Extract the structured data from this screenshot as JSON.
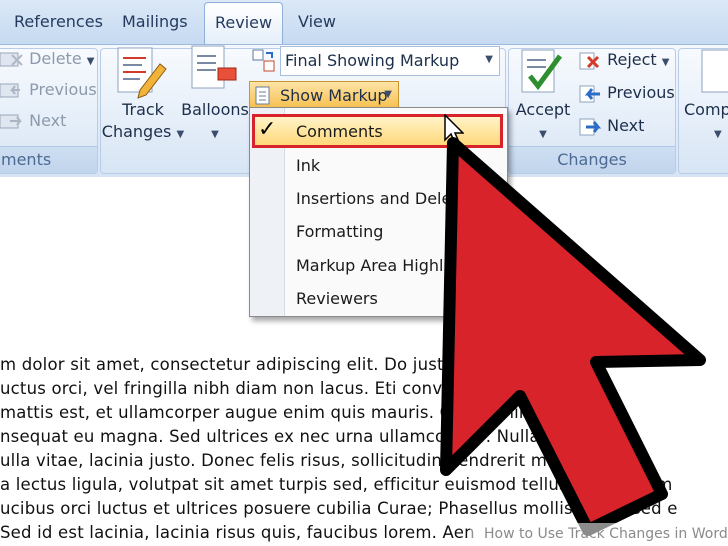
{
  "tabs": [
    {
      "label": "References",
      "active": false
    },
    {
      "label": "Mailings",
      "active": false
    },
    {
      "label": "Review",
      "active": true
    },
    {
      "label": "View",
      "active": false
    }
  ],
  "comments_group": {
    "label": "ments",
    "delete": "Delete",
    "previous": "Previous",
    "next": "Next"
  },
  "tracking_group": {
    "track_changes_line1": "Track",
    "track_changes_line2": "Changes",
    "balloons": "Balloons",
    "markup_select": "Final Showing Markup",
    "show_markup": "Show Markup"
  },
  "changes_group": {
    "label": "Changes",
    "accept": "Accept",
    "reject": "Reject",
    "previous": "Previous",
    "next": "Next"
  },
  "compare_group": {
    "label": "Comp"
  },
  "show_markup_menu": {
    "items": [
      {
        "label": "Comments",
        "checked": true,
        "highlighted": true
      },
      {
        "label": "Ink",
        "checked": false
      },
      {
        "label": "Insertions and Deleti",
        "checked": false
      },
      {
        "label": "Formatting",
        "checked": false
      },
      {
        "label": "Markup Area Highlig",
        "checked": false
      },
      {
        "label": "Reviewers",
        "checked": false
      }
    ],
    "check_glyph": "✓"
  },
  "document": {
    "lines": [
      "m dolor sit amet, consectetur adipiscing elit. Do                    justo nec vestibu",
      "uctus orci, vel fringilla nibh diam non lacus. Eti          conv       llis nec maximu",
      " mattis est, et ullamcorper augue enim quis mauris. Quisq           enim, efficitu",
      "nsequat eu magna. Sed ultrices ex nec urna ullamcorper             . Nulla ac er",
      "ulla vitae, lacinia justo. Donec felis risus, sollicitudin hendrerit mattis eget, c",
      "a lectus ligula, volutpat sit amet turpis sed, efficitur euismod tellus. Vestibulum",
      "ucibus orci luctus et ultrices posuere cubilia Curae; Phasellus mollis lorem sed e",
      "Sed id est lacinia, lacinia risus quis, faucibus lorem.  Aen"
    ]
  },
  "watermark": "How to Use Track Changes in Word",
  "colors": {
    "accent_red": "#d8232a",
    "arrow_outline": "#000000",
    "ribbon_label": "#4c6a93",
    "highlight_fill": "#ffd87a"
  }
}
